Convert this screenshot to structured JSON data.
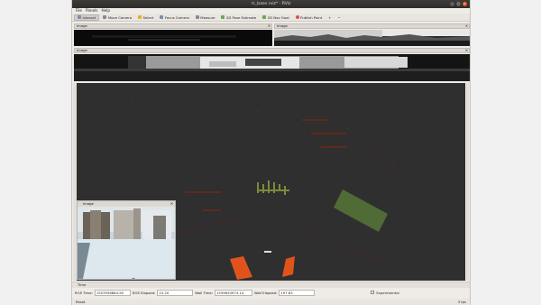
{
  "window": {
    "title": "rc_base.rviz* - RViz"
  },
  "menu": [
    "File",
    "Panels",
    "Help"
  ],
  "toolbar": [
    {
      "label": "Interact",
      "icon": "cursor-icon",
      "active": true
    },
    {
      "label": "Move Camera",
      "icon": "move-camera-icon"
    },
    {
      "label": "Select",
      "icon": "select-icon"
    },
    {
      "label": "Focus Camera",
      "icon": "focus-camera-icon"
    },
    {
      "label": "Measure",
      "icon": "ruler-icon"
    },
    {
      "label": "2D Pose Estimate",
      "icon": "pose-estimate-icon"
    },
    {
      "label": "2D Nav Goal",
      "icon": "nav-goal-icon"
    },
    {
      "label": "Publish Point",
      "icon": "publish-point-icon"
    }
  ],
  "panels": {
    "image_left_title": "Image",
    "image_right_title": "Image",
    "image_main_title": "Image",
    "image_float_title": "Image"
  },
  "time": {
    "panel_title": "Time",
    "ros_time_label": "ROS Time:",
    "ros_time_value": "1553556884.95",
    "ros_elapsed_label": "ROS Elapsed:",
    "ros_elapsed_value": "15.20",
    "wall_time_label": "Wall Time:",
    "wall_time_value": "1559620974.14",
    "wall_elapsed_label": "Wall Elapsed:",
    "wall_elapsed_value": "197.83",
    "experimental_label": "Experimental"
  },
  "status": {
    "reset_label": "Reset",
    "fps": "3 fps"
  },
  "colors": {
    "accent": "#e95420",
    "viewport_bg": "#2e2e2e"
  }
}
